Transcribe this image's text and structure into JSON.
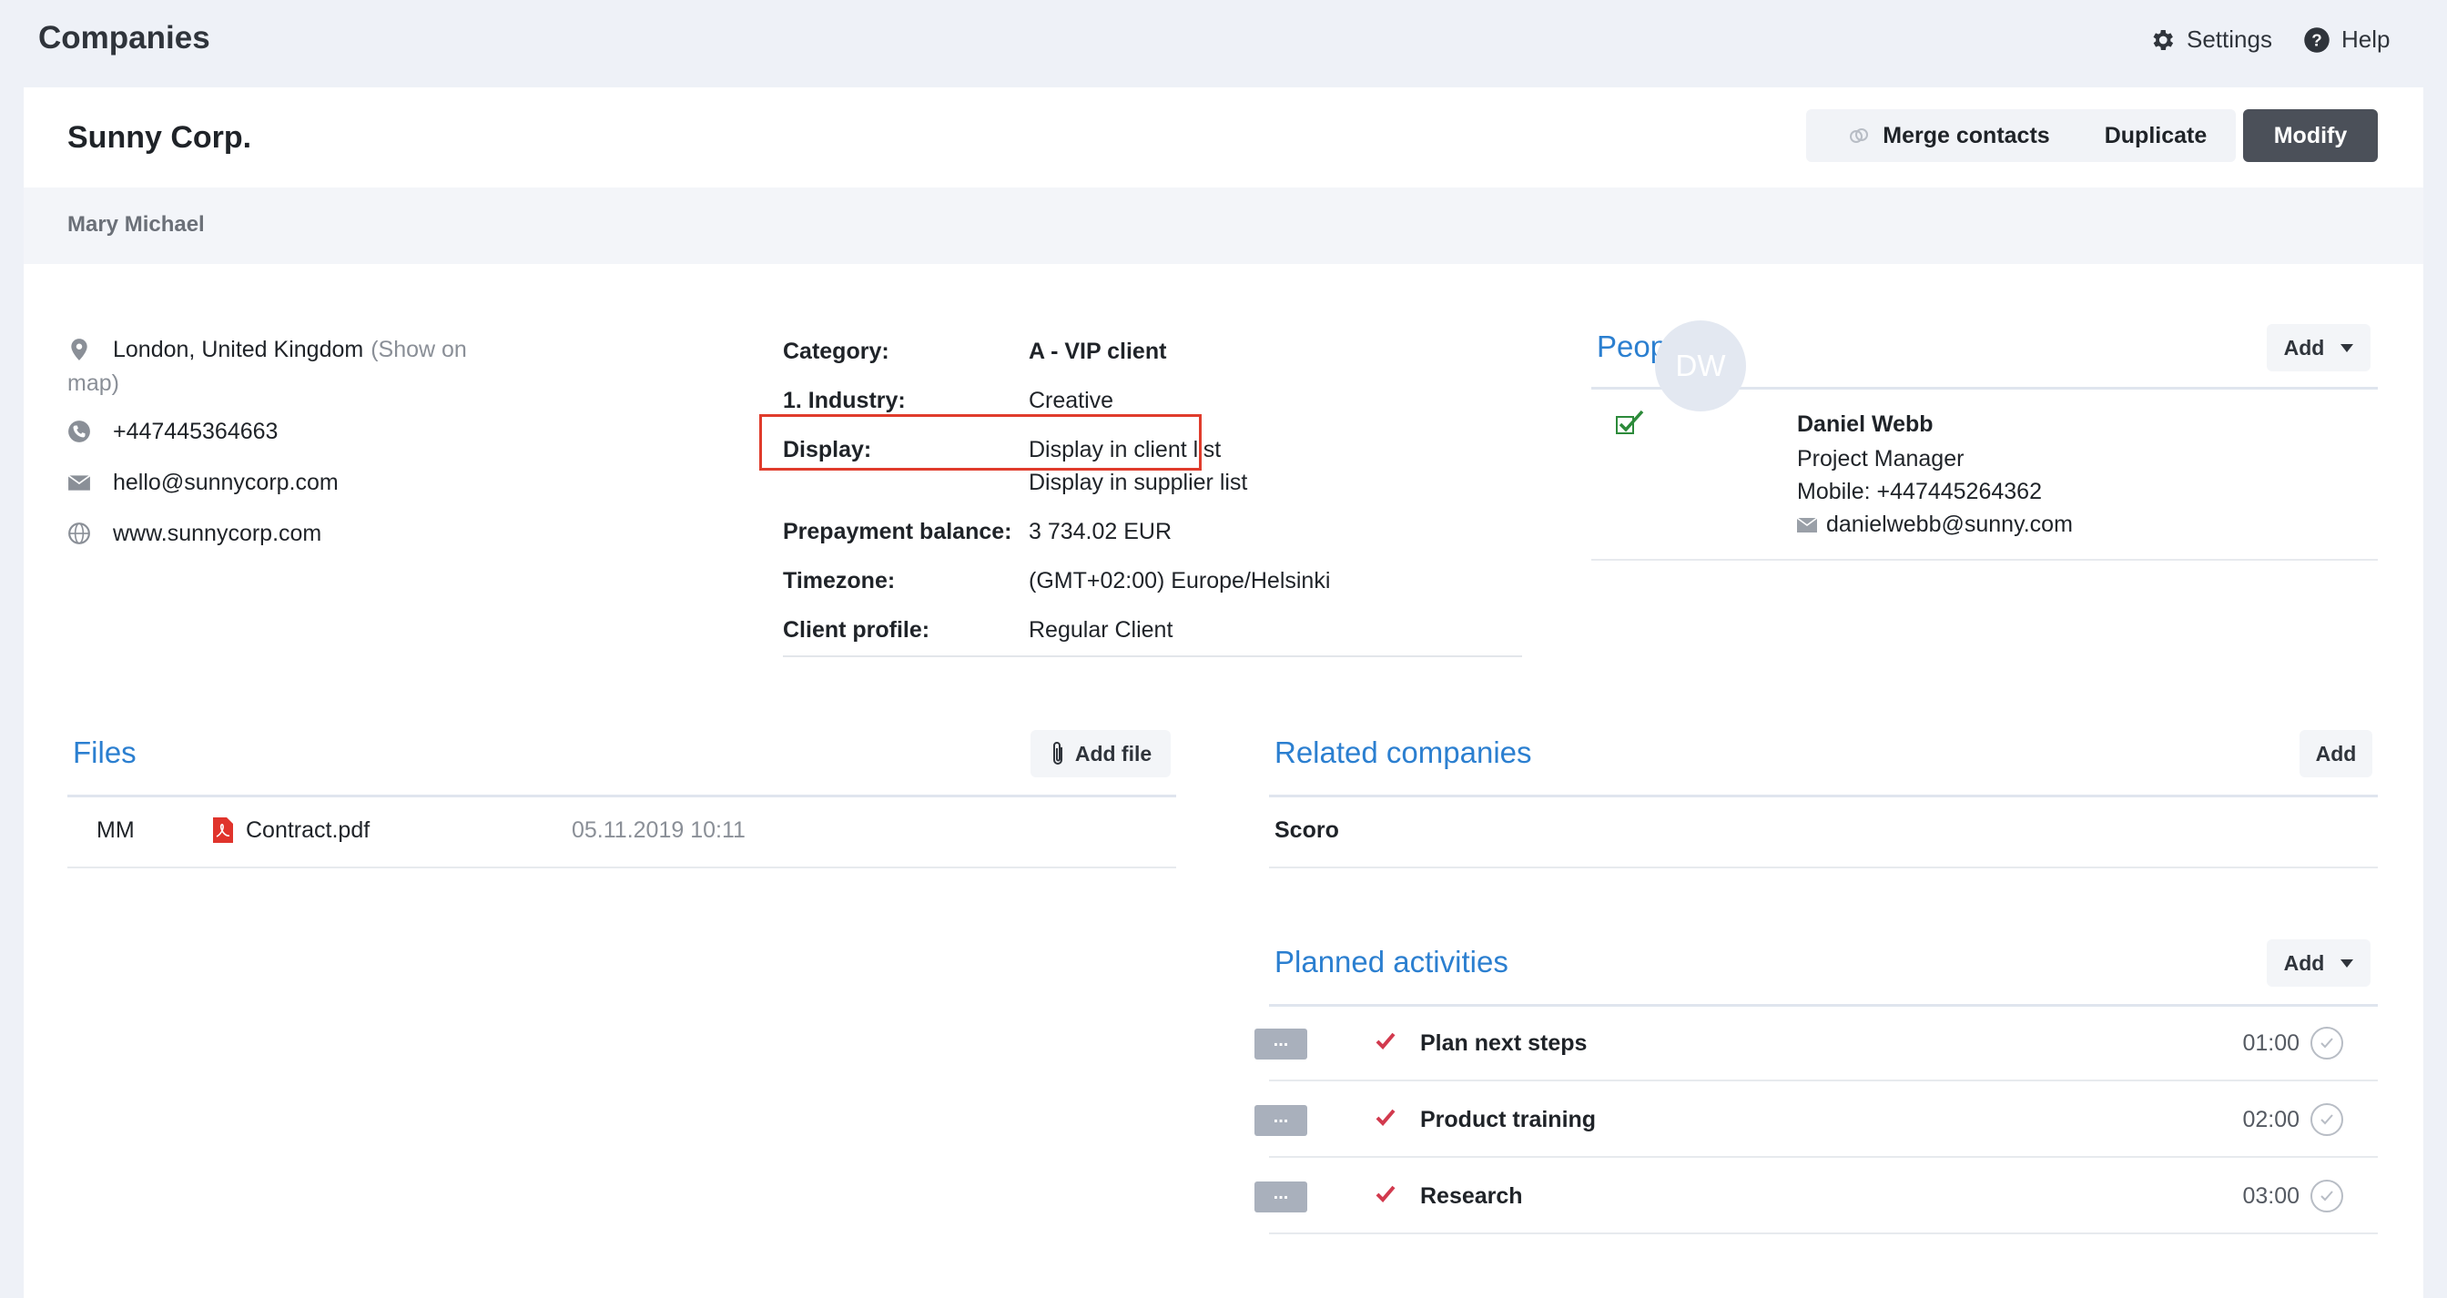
{
  "app": {
    "title": "Companies",
    "settings_label": "Settings",
    "help_label": "Help"
  },
  "company": {
    "name": "Sunny Corp.",
    "owner": "Mary Michael",
    "actions": {
      "merge_label": "Merge contacts",
      "duplicate_label": "Duplicate",
      "modify_label": "Modify"
    }
  },
  "contact": {
    "address": "London, United Kingdom",
    "show_on_map_line1": "(Show on",
    "show_on_map_line2": "map)",
    "phone": "+447445364663",
    "email": "hello@sunnycorp.com",
    "website": "www.sunnycorp.com"
  },
  "details": {
    "category_label": "Category:",
    "category_value": "A - VIP client",
    "industry_label": "1. Industry:",
    "industry_value": "Creative",
    "display_label": "Display:",
    "display_value_1": "Display in client list",
    "display_value_2": "Display in supplier list",
    "prepayment_label": "Prepayment balance:",
    "prepayment_value": "3 734.02 EUR",
    "timezone_label": "Timezone:",
    "timezone_value": "(GMT+02:00) Europe/Helsinki",
    "profile_label": "Client profile:",
    "profile_value": "Regular Client"
  },
  "people": {
    "title": "People",
    "add_label": "Add",
    "person": {
      "initials": "DW",
      "name": "Daniel Webb",
      "role": "Project Manager",
      "mobile": "Mobile: +447445264362",
      "email": "danielwebb@sunny.com"
    }
  },
  "files": {
    "title": "Files",
    "add_label": "Add file",
    "items": [
      {
        "owner": "MM",
        "name": "Contract.pdf",
        "date": "05.11.2019 10:11"
      }
    ]
  },
  "related": {
    "title": "Related companies",
    "add_label": "Add",
    "items": [
      {
        "name": "Scoro"
      }
    ]
  },
  "activities": {
    "title": "Planned activities",
    "add_label": "Add",
    "handle_label": "...",
    "items": [
      {
        "name": "Plan next steps",
        "time": "01:00"
      },
      {
        "name": "Product training",
        "time": "02:00"
      },
      {
        "name": "Research",
        "time": "03:00"
      }
    ]
  },
  "colors": {
    "accent": "#2b7fd0",
    "highlight": "#e03c2c",
    "primary_button": "#4b5059",
    "check": "#d23a4e"
  }
}
